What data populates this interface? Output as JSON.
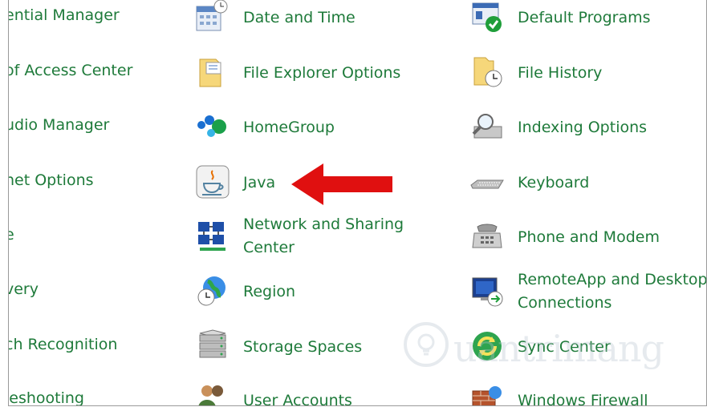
{
  "col1": [
    "ential Manager",
    "of Access Center",
    "udio Manager",
    "net Options",
    "e",
    "very",
    "ch Recognition",
    "leshooting"
  ],
  "col2": [
    "Date and Time",
    "File Explorer Options",
    "HomeGroup",
    "Java",
    "Network and Sharing Center",
    "Region",
    "Storage Spaces",
    "User Accounts"
  ],
  "col3": [
    "Default Programs",
    "File History",
    "Indexing Options",
    "Keyboard",
    "Phone and Modem",
    "RemoteApp and Desktop Connections",
    "Sync Center",
    "Windows Firewall"
  ],
  "watermark": {
    "text": "uantrimang"
  },
  "colors": {
    "link": "#1e7a3a",
    "arrow": "#e01010"
  }
}
